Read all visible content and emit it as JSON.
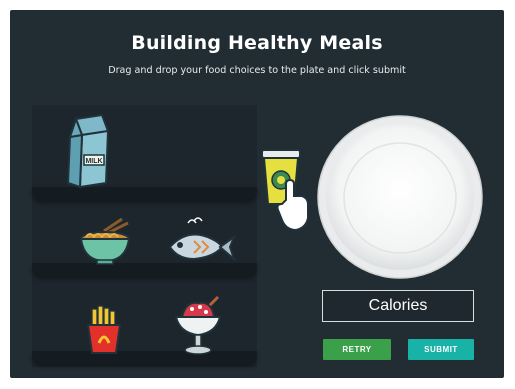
{
  "header": {
    "title": "Building Healthy Meals",
    "subtitle": "Drag and drop your food choices to the plate and click submit"
  },
  "food_items": {
    "milk": {
      "icon": "milk-carton-icon",
      "label": "MILK"
    },
    "noodles": {
      "icon": "noodle-bowl-icon"
    },
    "fish": {
      "icon": "fish-icon"
    },
    "fries": {
      "icon": "french-fries-icon"
    },
    "sundae": {
      "icon": "ice-cream-sundae-icon"
    },
    "drink": {
      "icon": "drink-cup-icon"
    }
  },
  "plate": {
    "icon": "plate-icon"
  },
  "calories": {
    "label": "Calories"
  },
  "buttons": {
    "retry_label": "RETRY",
    "submit_label": "SUBMIT"
  },
  "colors": {
    "background": "#222c33",
    "shelf_panel": "#1d262c",
    "retry": "#3aa14a",
    "submit": "#18b2a7"
  }
}
